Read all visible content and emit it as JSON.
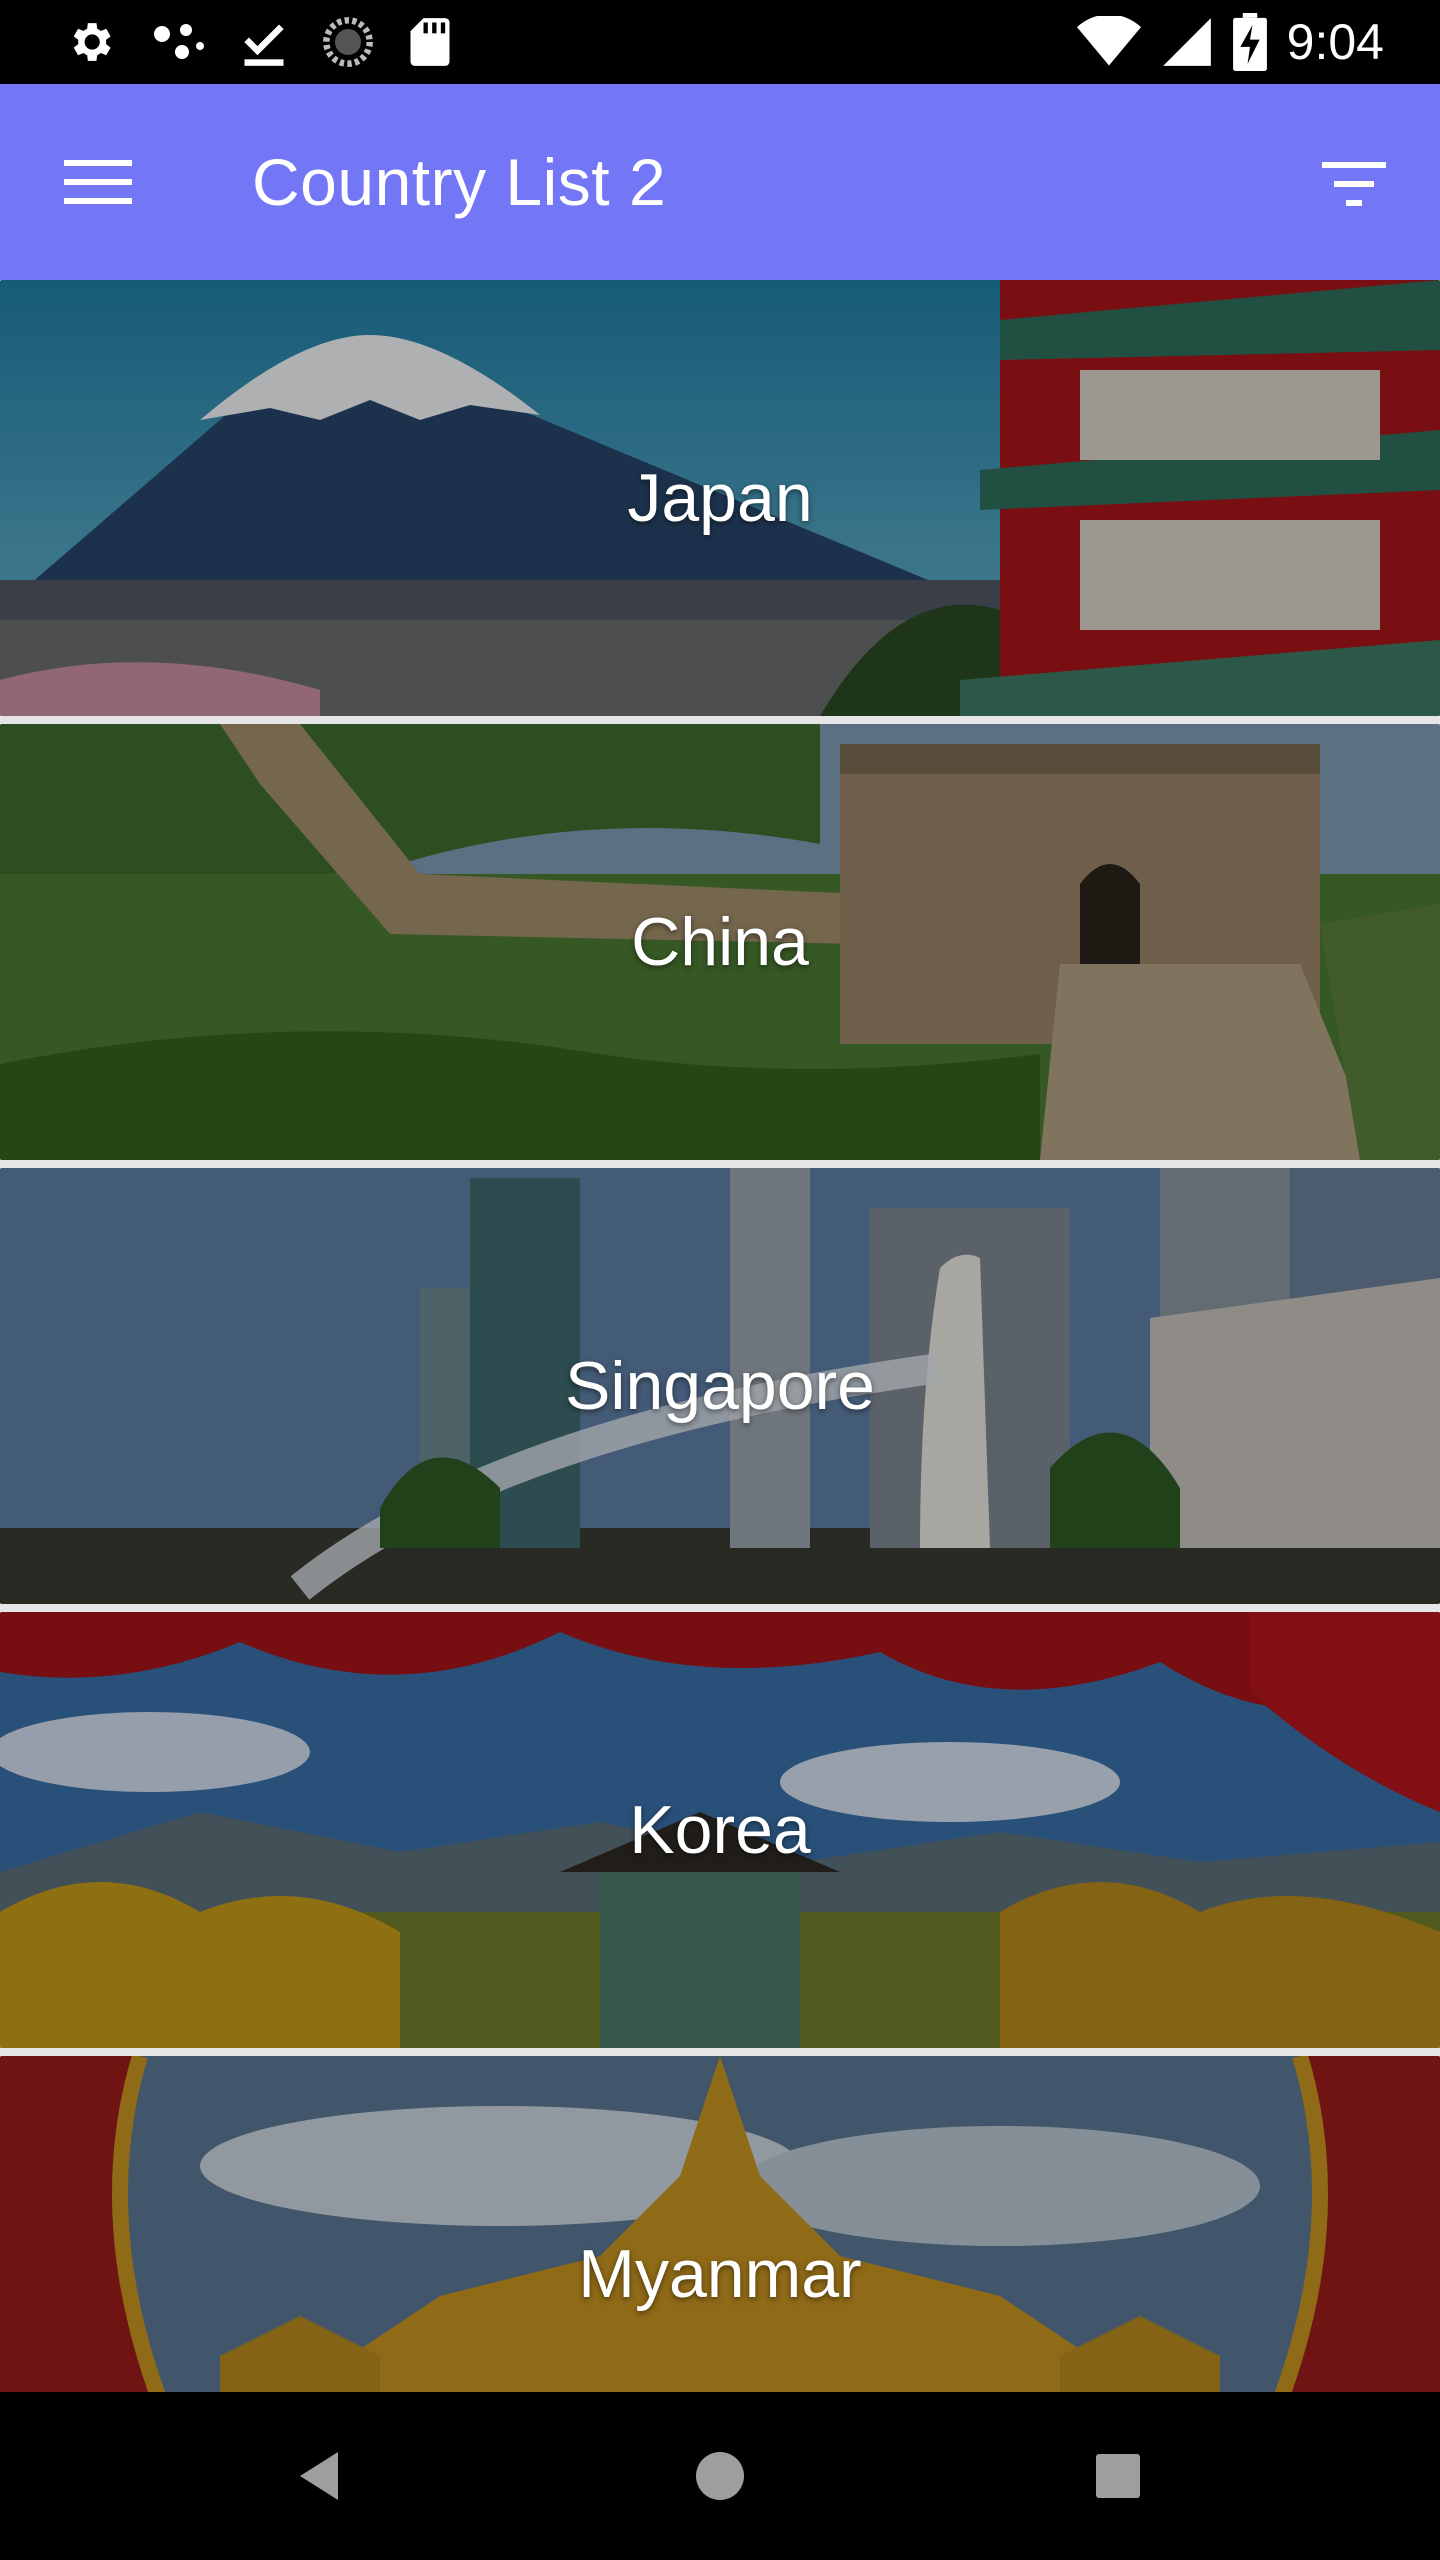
{
  "status_bar": {
    "time": "9:04",
    "left_icons": [
      "settings-icon",
      "connection-icon",
      "download-done-icon",
      "sync-icon",
      "sd-card-icon"
    ],
    "right_icons": [
      "wifi-icon",
      "signal-icon",
      "battery-charging-icon"
    ]
  },
  "app_bar": {
    "title": "Country List 2",
    "background": "#7477F5",
    "menu_icon": "menu-icon",
    "filter_icon": "filter-icon"
  },
  "countries": [
    {
      "name": "Japan"
    },
    {
      "name": "China"
    },
    {
      "name": "Singapore"
    },
    {
      "name": "Korea"
    },
    {
      "name": "Myanmar"
    }
  ],
  "nav_bar": {
    "icons": [
      "back-icon",
      "home-icon",
      "recents-icon"
    ]
  }
}
